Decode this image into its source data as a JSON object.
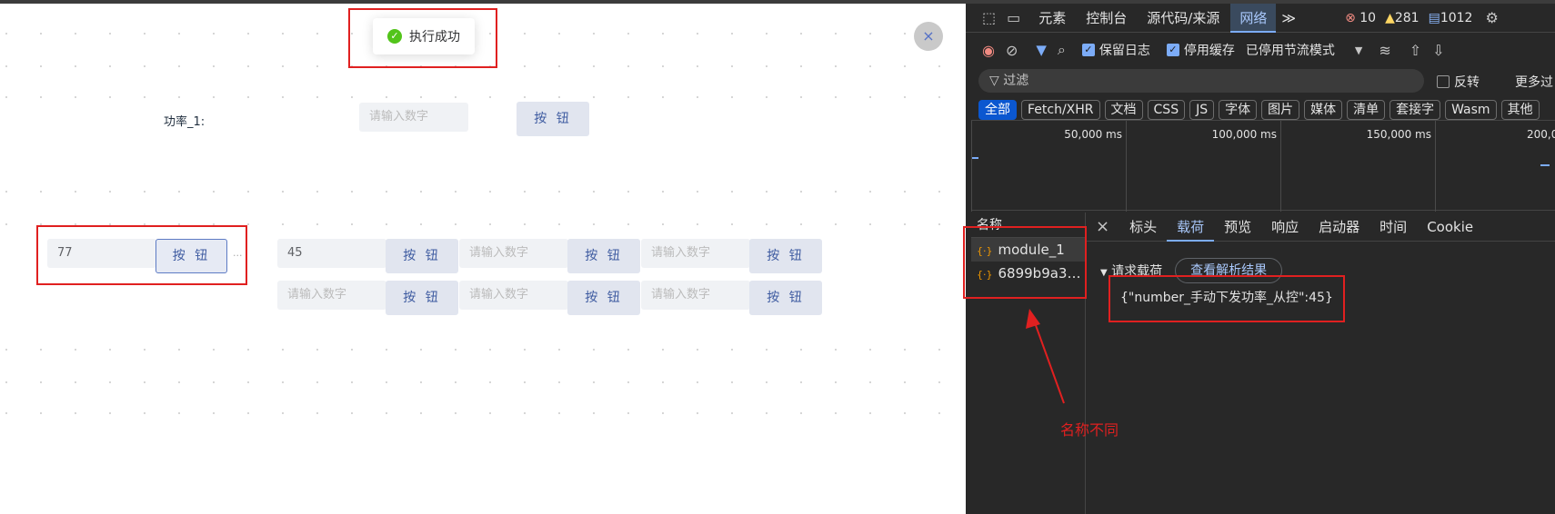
{
  "toast": {
    "text": "执行成功"
  },
  "close_icon": "×",
  "form": {
    "power_label": "功率_1:",
    "placeholder": "请输入数字",
    "button_label": "按 钮",
    "field_77": "77",
    "field_45": "45",
    "ellipsis": "..."
  },
  "devtools": {
    "tabs": [
      "元素",
      "控制台",
      "源代码/来源",
      "网络"
    ],
    "more": "≫",
    "counts": {
      "errors": "10",
      "warnings": "281",
      "messages": "1012"
    },
    "toolbar": {
      "preserve_log": "保留日志",
      "disable_cache": "停用缓存",
      "throttle": "已停用节流模式"
    },
    "filter": {
      "placeholder": "过滤",
      "invert": "反转",
      "more_filters": "更多过"
    },
    "types": [
      "全部",
      "Fetch/XHR",
      "文档",
      "CSS",
      "JS",
      "字体",
      "图片",
      "媒体",
      "清单",
      "套接字",
      "Wasm",
      "其他"
    ],
    "timeline_ticks": [
      "50,000 ms",
      "100,000 ms",
      "150,000 ms",
      "200,0"
    ],
    "names_header": "名称",
    "requests": [
      "module_1",
      "6899b9a36..."
    ],
    "detail_tabs": [
      "标头",
      "载荷",
      "预览",
      "响应",
      "启动器",
      "时间",
      "Cookie"
    ],
    "payload_section": "请求载荷",
    "parse_button": "查看解析结果",
    "payload_body": "{\"number_手动下发功率_从控\":45}"
  },
  "annotation": "名称不同"
}
